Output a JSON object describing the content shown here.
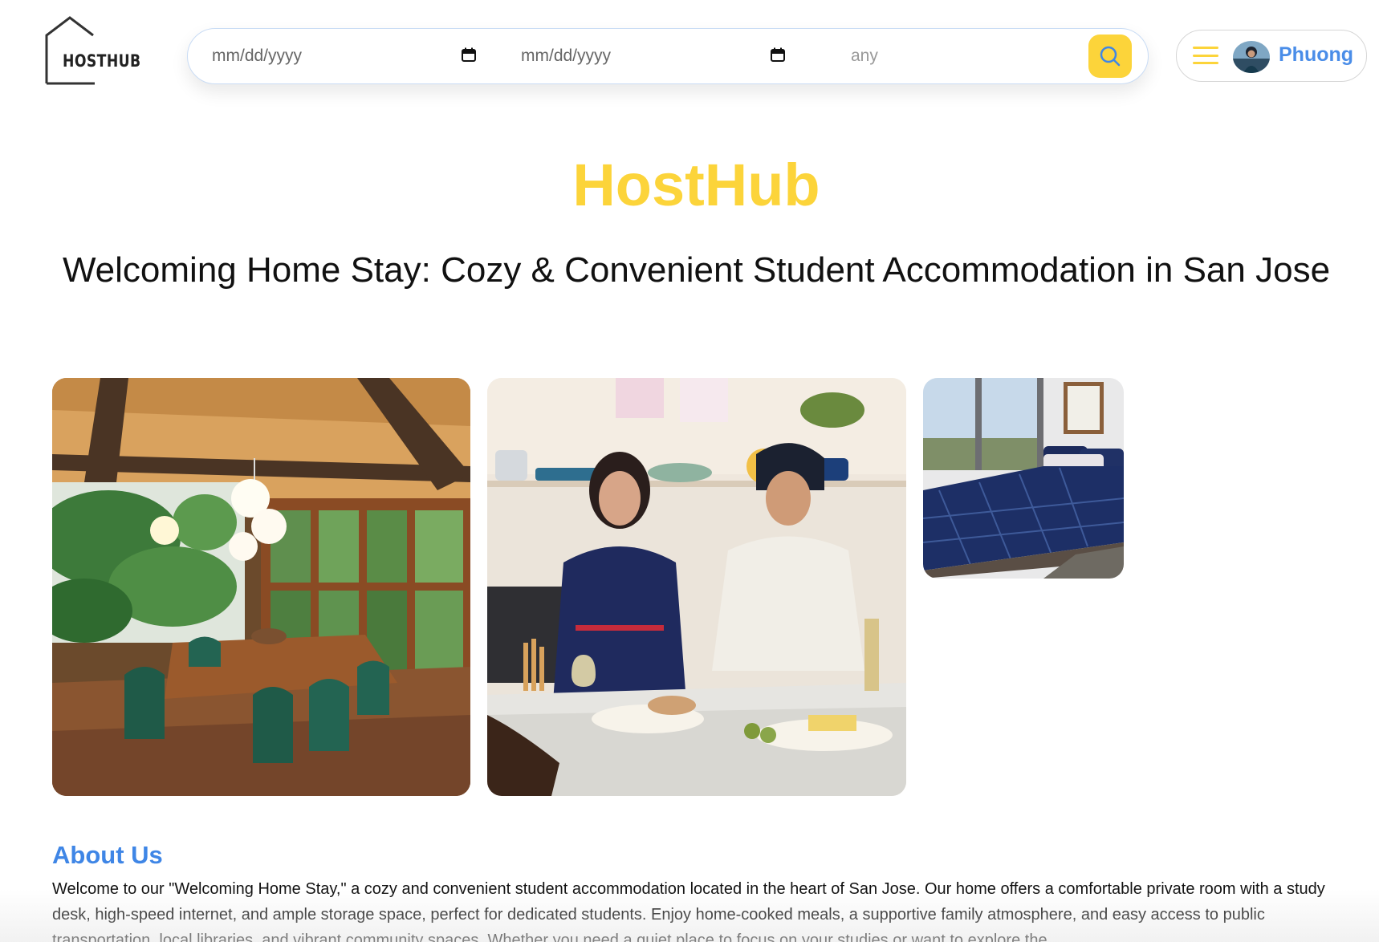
{
  "header": {
    "logo_text": "HOSTHUB",
    "check_in": {
      "value": "mm/dd/yyyy"
    },
    "check_out": {
      "value": "mm/dd/yyyy"
    },
    "guests": {
      "value": "any"
    },
    "search_icon": "search-icon",
    "menu_icon": "hamburger-icon",
    "user_name": "Phuong"
  },
  "main": {
    "brand_title": "HostHub",
    "listing_title": "Welcoming Home Stay: Cozy & Convenient Student Accommodation in San Jose",
    "photos": [
      "dining-room-photo",
      "kitchen-photo",
      "bedroom-photo"
    ],
    "about": {
      "heading": "About Us",
      "text": "Welcome to our \"Welcoming Home Stay,\" a cozy and convenient student accommodation located in the heart of San Jose. Our home offers a comfortable private room with a study desk, high-speed internet, and ample storage space, perfect for dedicated students. Enjoy home-cooked meals, a supportive family atmosphere, and easy access to public transportation, local libraries, and vibrant community spaces. Whether you need a quiet place to focus on your studies or want to explore the"
    }
  },
  "colors": {
    "accent_yellow": "#fcd43a",
    "accent_blue": "#3f86e6",
    "text": "#111111"
  }
}
